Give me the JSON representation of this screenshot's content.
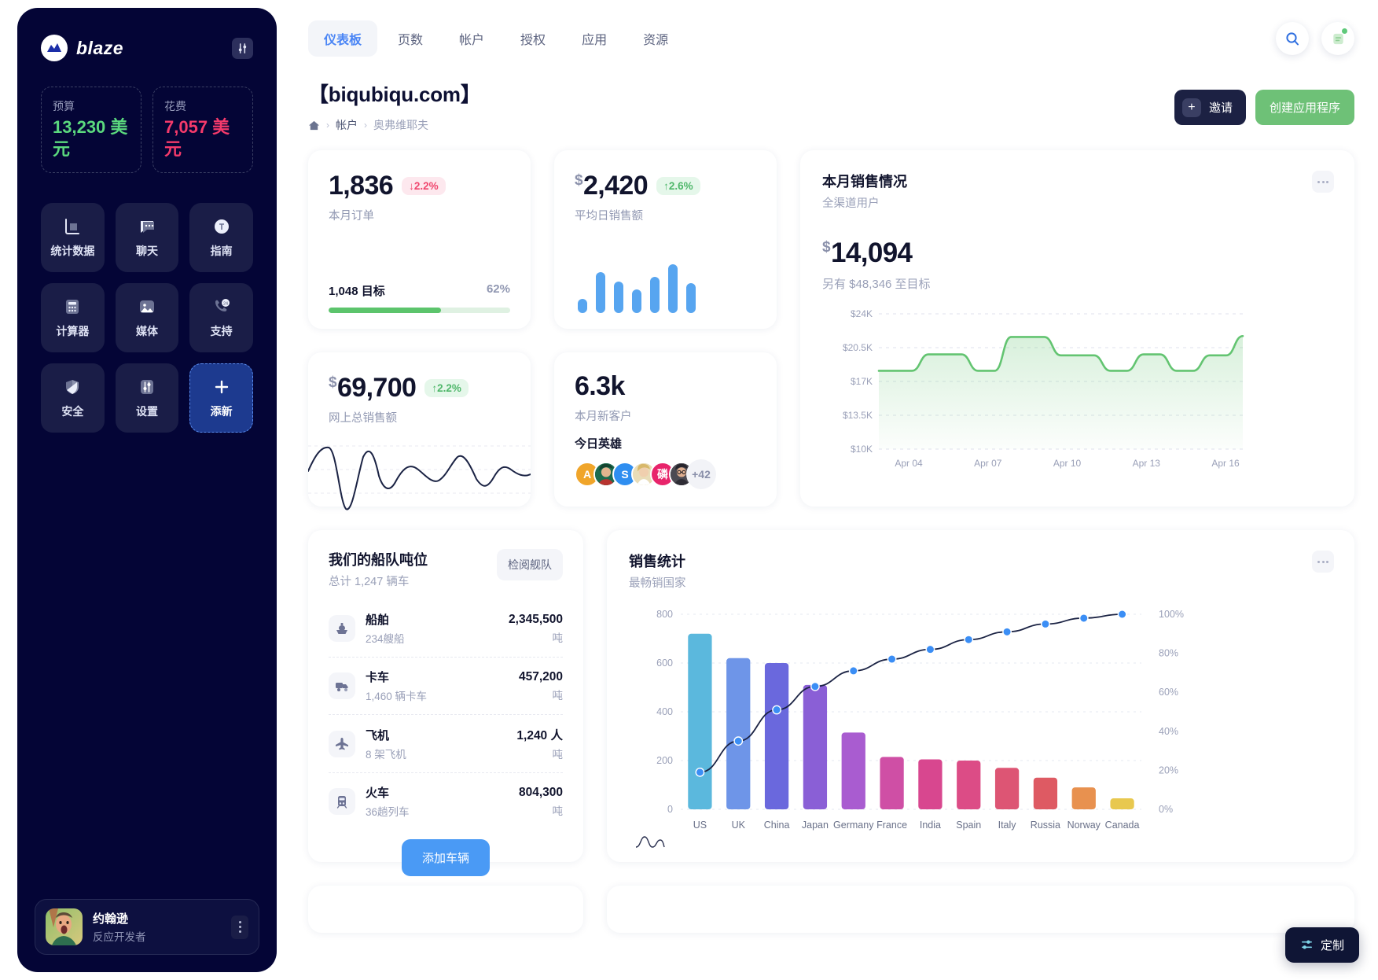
{
  "sidebar": {
    "brand": "blaze",
    "settings_icon": "sliders-icon",
    "budget": {
      "label": "预算",
      "value": "13,230 美元"
    },
    "spend": {
      "label": "花费",
      "value": "7,057 美元"
    },
    "tiles": [
      {
        "label": "统计数据",
        "icon": "bar-chart-icon"
      },
      {
        "label": "聊天",
        "icon": "chat-bubble-icon"
      },
      {
        "label": "指南",
        "icon": "compass-icon"
      },
      {
        "label": "计算器",
        "icon": "calculator-icon"
      },
      {
        "label": "媒体",
        "icon": "image-icon"
      },
      {
        "label": "支持",
        "icon": "phone-24-icon"
      },
      {
        "label": "安全",
        "icon": "shield-icon"
      },
      {
        "label": "设置",
        "icon": "sliders-icon"
      },
      {
        "label": "添新",
        "icon": "plus-icon"
      }
    ],
    "profile": {
      "name": "约翰逊",
      "role": "反应开发者",
      "menu_icon": "kebab-menu-icon"
    }
  },
  "topnav": {
    "tabs": [
      {
        "label": "仪表板",
        "active": true
      },
      {
        "label": "页数",
        "active": false
      },
      {
        "label": "帐户",
        "active": false
      },
      {
        "label": "授权",
        "active": false
      },
      {
        "label": "应用",
        "active": false
      },
      {
        "label": "资源",
        "active": false
      }
    ],
    "search_icon": "search-icon",
    "notes_icon": "note-icon"
  },
  "header": {
    "title": "【biqubiqu.com】",
    "breadcrumb": {
      "home_icon": "home-icon",
      "items": [
        "帐户",
        "奥弗维耶夫"
      ],
      "separator": "›"
    },
    "invite_button": "邀请",
    "create_button": "创建应用程序"
  },
  "kpi": {
    "orders": {
      "value": "1,836",
      "delta": "2.2%",
      "delta_dir": "down",
      "label": "本月订单",
      "goal_label": "1,048 目标",
      "goal_percent": "62%",
      "progress": 62
    },
    "avg_daily": {
      "currency": "$",
      "value": "2,420",
      "delta": "2.6%",
      "delta_dir": "up",
      "label": "平均日销售额"
    },
    "online_total": {
      "currency": "$",
      "value": "69,700",
      "delta": "2.2%",
      "delta_dir": "up",
      "label": "网上总销售额"
    },
    "new_customers": {
      "value": "6.3k",
      "label": "本月新客户",
      "heroes_label": "今日英雄",
      "avatars": [
        "A",
        "",
        "S",
        "",
        "磷",
        ""
      ],
      "more": "+42"
    }
  },
  "monthly_sales": {
    "title": "本月销售情况",
    "subtitle": "全渠道用户",
    "currency": "$",
    "amount": "14,094",
    "note": "另有 $48,346 至目标",
    "menu_icon": "kebab-menu-icon"
  },
  "fleet": {
    "title": "我们的船队吨位",
    "subtitle": "总计 1,247 辆车",
    "action": "检阅舰队",
    "rows": [
      {
        "icon": "ship-icon",
        "name": "船舶",
        "sub": "234艘船",
        "value": "2,345,500",
        "unit": "吨"
      },
      {
        "icon": "truck-icon",
        "name": "卡车",
        "sub": "1,460 辆卡车",
        "value": "457,200",
        "unit": "吨"
      },
      {
        "icon": "plane-icon",
        "name": "飞机",
        "sub": "8 架飞机",
        "value": "1,240 人",
        "unit": "吨"
      },
      {
        "icon": "train-icon",
        "name": "火车",
        "sub": "36趟列车",
        "value": "804,300",
        "unit": "吨"
      }
    ],
    "add_button": "添加车辆"
  },
  "sales_stats": {
    "title": "销售统计",
    "subtitle": "最畅销国家",
    "menu_icon": "kebab-menu-icon",
    "legend_icon": "wave-icon"
  },
  "customize": {
    "label": "定制",
    "icon": "sliders-icon"
  },
  "chart_data": [
    {
      "type": "area",
      "title": "本月销售情况",
      "xlabel": "",
      "ylabel": "",
      "ytick_labels": [
        "$24K",
        "$20.5K",
        "$17K",
        "$13.5K",
        "$10K"
      ],
      "ylim": [
        10000,
        24000
      ],
      "xtick_labels": [
        "Apr 04",
        "Apr 07",
        "Apr 10",
        "Apr 13",
        "Apr 16"
      ],
      "grid": true,
      "line_color": "#63c471",
      "values": [
        18100,
        18100,
        18100,
        19800,
        19800,
        19800,
        18100,
        18100,
        21600,
        21600,
        21600,
        19700,
        19700,
        19700,
        18100,
        18100,
        19800,
        19800,
        18100,
        18100,
        19700,
        19700,
        21700
      ]
    },
    {
      "type": "line",
      "title": "网上总销售额",
      "grid": true,
      "line_color": "#1b2344",
      "values": [
        48,
        62,
        55,
        12,
        70,
        35,
        40,
        60,
        52,
        48,
        44,
        30,
        34,
        64,
        40,
        26,
        58,
        50,
        38,
        48
      ]
    },
    {
      "type": "bar",
      "title": "平均日销售额",
      "bar_color": "#57a5f0",
      "values": [
        18,
        52,
        40,
        30,
        46,
        62,
        38
      ]
    },
    {
      "type": "bar",
      "title": "销售统计",
      "subtitle": "最畅销国家",
      "categories": [
        "US",
        "UK",
        "China",
        "Japan",
        "Germany",
        "France",
        "India",
        "Spain",
        "Italy",
        "Russia",
        "Norway",
        "Canada"
      ],
      "values": [
        720,
        620,
        600,
        510,
        315,
        215,
        205,
        200,
        170,
        130,
        90,
        45
      ],
      "ylim": [
        0,
        800
      ],
      "ytick_labels": [
        "0",
        "200",
        "400",
        "600",
        "800"
      ],
      "y2_label": "%",
      "y2tick_labels": [
        "0%",
        "20%",
        "40%",
        "60%",
        "80%",
        "100%"
      ],
      "y2lim": [
        0,
        100
      ],
      "bar_colors": [
        "#5bb8dd",
        "#6e95e8",
        "#6a68dd",
        "#8a5fd6",
        "#a95cd0",
        "#cf4fa5",
        "#d8478f",
        "#dc4c86",
        "#dd5574",
        "#de5a63",
        "#e8914f",
        "#e8c84f"
      ],
      "series": [
        {
          "name": "cumulative",
          "type": "line",
          "axis": "y2",
          "color": "#1b2344",
          "marker_color": "#3b8ef5",
          "values": [
            19,
            35,
            51,
            63,
            71,
            77,
            82,
            87,
            91,
            95,
            98,
            100
          ]
        }
      ]
    }
  ]
}
